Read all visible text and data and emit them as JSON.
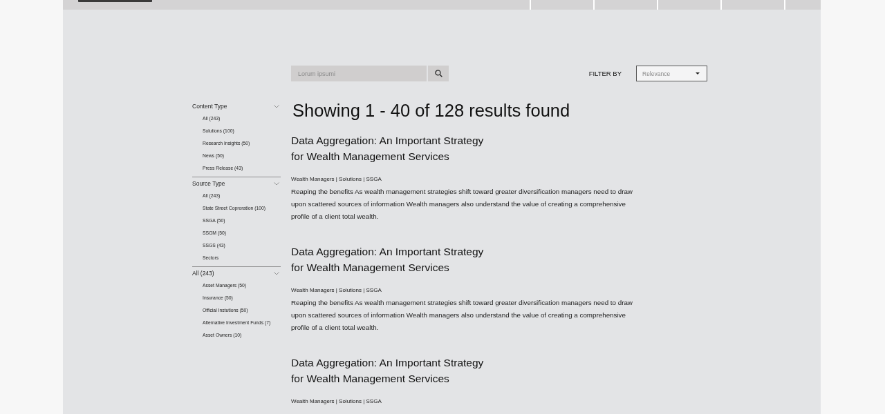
{
  "search": {
    "placeholder": "Lorum ipsumi"
  },
  "filter": {
    "label": "FILTER BY",
    "value": "Relevance"
  },
  "sidebar": {
    "sections": [
      {
        "title": "Content Type",
        "expanded": true,
        "items": [
          "All (243)",
          "Solutions (100)",
          "Research Insights (50)",
          "News (50)",
          "Press Release (43)"
        ]
      },
      {
        "title": "Source Type",
        "expanded": true,
        "items": [
          "All (243)",
          "State Street Coproration (100)",
          "SSGA (50)",
          "SSGM (50)",
          "SSGS (43)",
          "Sectors"
        ]
      },
      {
        "title": "All (243)",
        "expanded": true,
        "items": [
          "Asset Managers (50)",
          "Insurance (50)",
          "Official Instutions (50)",
          "Alternative Investment Funds (7)",
          "Asset Owners (10)"
        ]
      }
    ]
  },
  "results_heading": "Showing 1 - 40 of 128 results found",
  "results": [
    {
      "title": "Data Aggregation: An Important Strategy for Wealth Management Services",
      "meta": "Wealth Managers | Solutions | SSGA",
      "body": "Reaping the benefits As wealth management strategies shift toward greater diversification managers need to draw upon scattered sources of information Wealth managers also understand the value of creating a comprehensive profile of a client total wealth."
    },
    {
      "title": "Data Aggregation: An Important Strategy for Wealth Management Services",
      "meta": "Wealth Managers | Solutions | SSGA",
      "body": "Reaping the benefits As wealth management strategies shift toward greater diversification managers need to draw upon scattered sources of information Wealth managers also understand the value of creating a comprehensive profile of a client total wealth."
    },
    {
      "title": "Data Aggregation: An Important Strategy for Wealth Management Services",
      "meta": "Wealth Managers | Solutions | SSGA"
    }
  ]
}
